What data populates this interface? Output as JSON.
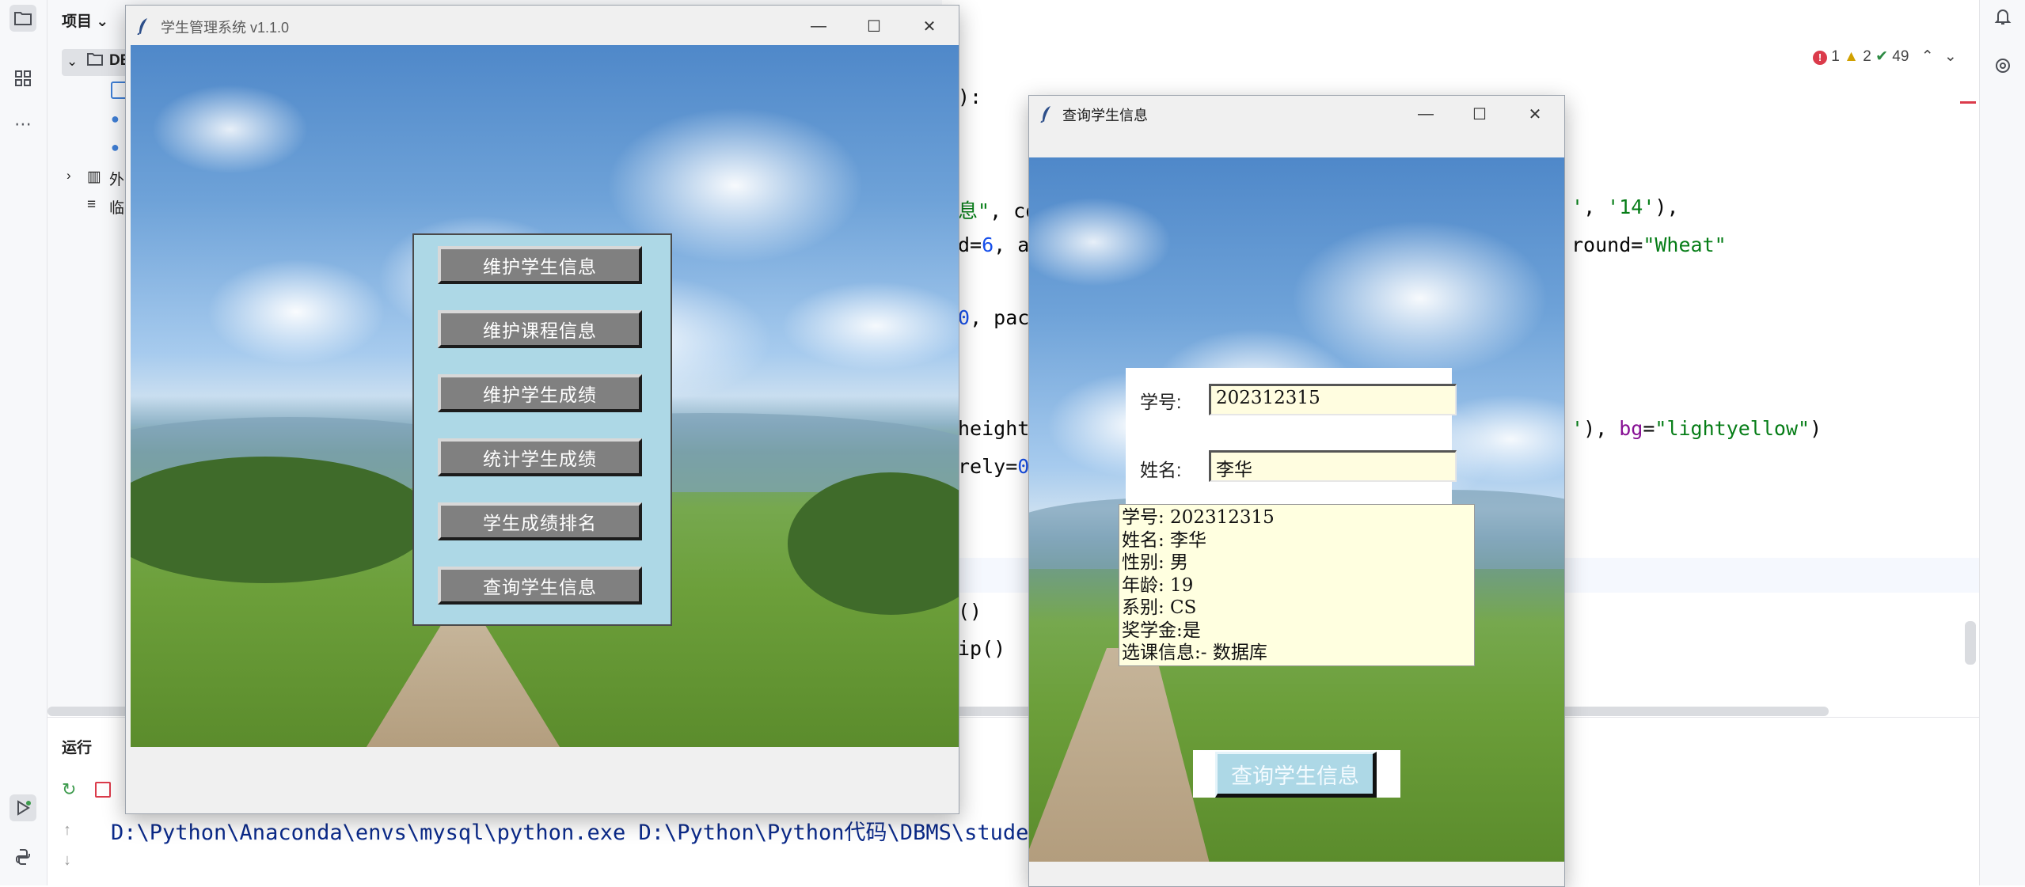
{
  "ide": {
    "project_label": "项目",
    "tree": {
      "root_label": "DB",
      "external_label": "外",
      "scratch_label": "临"
    },
    "code_lines": [
      {
        "parts": [
          [
            "",
            "):"
          ]
        ]
      },
      {
        "parts": [
          [
            "str",
            "息\""
          ],
          [
            "",
            ", co"
          ]
        ]
      },
      {
        "parts": [
          [
            "",
            "d="
          ],
          [
            "num",
            "6"
          ],
          [
            "",
            ", a"
          ]
        ]
      },
      {
        "parts": [
          [
            "num",
            "0"
          ],
          [
            "",
            ", pac"
          ]
        ]
      },
      {
        "parts": [
          [
            "",
            "height"
          ]
        ]
      },
      {
        "parts": [
          [
            "",
            "rely="
          ],
          [
            "num",
            "0"
          ]
        ]
      },
      {
        "parts": [
          [
            "",
            "()"
          ]
        ]
      },
      {
        "parts": [
          [
            "",
            "ip()"
          ]
        ]
      }
    ],
    "code_right_lines": [
      {
        "parts": [
          [
            "str",
            "'"
          ],
          [
            "",
            ", "
          ],
          [
            "str",
            "'14'"
          ],
          [
            "",
            "),"
          ]
        ]
      },
      {
        "parts": [
          [
            "",
            "round="
          ],
          [
            "str",
            "\"Wheat\""
          ]
        ]
      },
      {
        "parts": [
          [
            "str",
            "'"
          ],
          [
            "",
            "), "
          ],
          [
            "kw",
            "bg"
          ],
          [
            "",
            "="
          ],
          [
            "str",
            "\"lightyellow\""
          ],
          [
            "",
            ")"
          ]
        ]
      }
    ],
    "status": {
      "errors": "1",
      "warnings": "2",
      "ok": "49"
    },
    "run_tab_label": "运行",
    "run_command": "D:\\Python\\Anaconda\\envs\\mysql\\python.exe D:\\Python\\Python代码\\DBMS\\studen"
  },
  "main_window": {
    "title": "学生管理系统 v1.1.0",
    "menu_buttons": [
      "维护学生信息",
      "维护课程信息",
      "维护学生成绩",
      "统计学生成绩",
      "学生成绩排名",
      "查询学生信息"
    ]
  },
  "query_window": {
    "title": "查询学生信息",
    "student_id_label": "学号:",
    "student_id_value": "202312315",
    "name_label": "姓名:",
    "name_value": "李华",
    "result_lines": [
      "学号: 202312315",
      "姓名: 李华",
      "性别: 男",
      "年龄: 19",
      "系别: CS",
      "奖学金:是",
      "选课信息:- 数据库"
    ],
    "query_button_label": "查询学生信息"
  },
  "colors": {
    "menu_panel": "#add8e6",
    "menu_button": "#808080",
    "input_bg": "#fffde0",
    "result_bg": "#ffffe0",
    "query_button": "#add8e6"
  }
}
